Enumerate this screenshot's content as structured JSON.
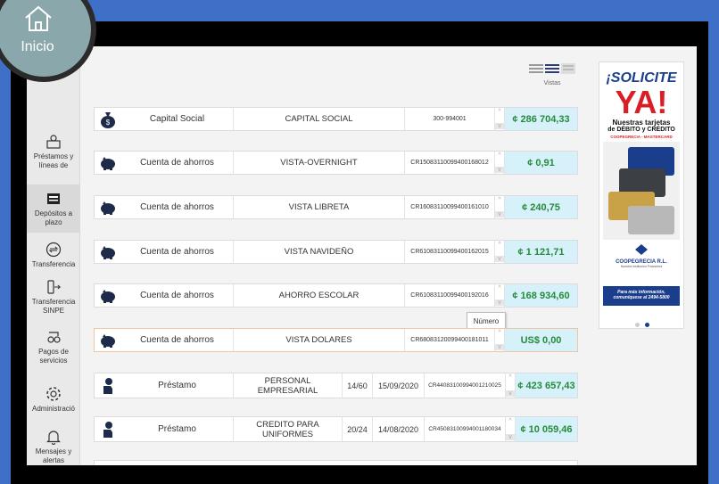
{
  "app": {
    "home_label": "Inicio",
    "views_label": "Vistas",
    "tooltip": "Número"
  },
  "sidebar": {
    "items": [
      {
        "label": "Préstamos y líneas de",
        "icon": "loan-icon"
      },
      {
        "label": "Depósitos a plazo",
        "icon": "deposit-icon"
      },
      {
        "label": "Transferencia",
        "icon": "transfer-icon"
      },
      {
        "label": "Transferencia SINPE",
        "icon": "sinpe-icon"
      },
      {
        "label": "Pagos de servicios",
        "icon": "services-icon"
      },
      {
        "label": "Administració",
        "icon": "gear-icon"
      },
      {
        "label": "Mensajes y alertas",
        "icon": "bell-icon"
      }
    ]
  },
  "accounts": [
    {
      "type": "Capital Social",
      "name": "CAPITAL SOCIAL",
      "number": "300-994001",
      "amount": "¢ 286 704,33",
      "icon": "money-bag-icon"
    },
    {
      "type": "Cuenta de ahorros",
      "name": "VISTA-OVERNIGHT",
      "number": "CR15083110099400168012",
      "amount": "¢ 0,91",
      "icon": "piggy-bank-icon"
    },
    {
      "type": "Cuenta de ahorros",
      "name": "VISTA LIBRETA",
      "number": "CR16083110099400161010",
      "amount": "¢ 240,75",
      "icon": "piggy-bank-icon"
    },
    {
      "type": "Cuenta de ahorros",
      "name": "VISTA NAVIDEÑO",
      "number": "CR61083110099400162015",
      "amount": "¢ 1 121,71",
      "icon": "piggy-bank-icon"
    },
    {
      "type": "Cuenta de ahorros",
      "name": "AHORRO ESCOLAR",
      "number": "CR61083110099400192016",
      "amount": "¢ 168 934,60",
      "icon": "piggy-bank-icon"
    },
    {
      "type": "Cuenta de ahorros",
      "name": "VISTA DOLARES",
      "number": "CR68083120099400181011",
      "amount": "US$ 0,00",
      "icon": "piggy-bank-icon"
    }
  ],
  "loans": [
    {
      "type": "Préstamo",
      "name": "PERSONAL EMPRESARIAL",
      "cuota": "14/60",
      "date": "15/09/2020",
      "number": "CR44083100994001210025",
      "amount": "¢ 423 657,43",
      "icon": "hand-money-icon"
    },
    {
      "type": "Préstamo",
      "name": "CREDITO PARA UNIFORMES",
      "cuota": "20/24",
      "date": "14/08/2020",
      "number": "CR45083100994001180034",
      "amount": "¢ 10 059,46",
      "icon": "hand-money-icon"
    }
  ],
  "ad": {
    "headline": "¡SOLICITE",
    "big": "YA!",
    "line1": "Nuestras tarjetas",
    "line2": "de DÉBITO y CRÉDITO",
    "line3": "COOPEGRECIA - MASTERCARD",
    "logo": "COOPEGRECIA R.L.",
    "logo_sub": "Nuestra Institución Financiera",
    "foot1": "Para más información,",
    "foot2": "comuníquese al 2494-5800"
  },
  "colors": {
    "amount_bg": "#d7f1fa",
    "amount_text": "#258a3a",
    "brand_blue": "#1a3e8c",
    "ad_red": "#d81f26",
    "frame_blue": "#3f70c8"
  }
}
